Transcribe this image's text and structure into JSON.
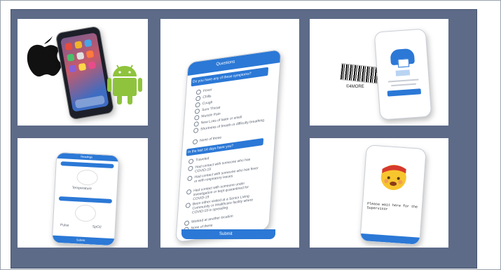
{
  "tiles": {
    "platforms": {
      "apple_icon": "apple-logo-icon",
      "android_icon": "android-robot-icon"
    },
    "questionnaire": {
      "header": "Questions",
      "q1": "Do you have any of these symptoms?",
      "symptoms": [
        "Fever",
        "Chills",
        "Cough",
        "Sore Throat",
        "Muscle Pain",
        "New Loss of taste or smell",
        "Shortness of breath or difficulty breathing",
        "None of these"
      ],
      "q2": "In the last 14 days have you?",
      "exposures": [
        "Traveled",
        "Had contact with someone who has COVID-19",
        "Had contact with someone who has fever or with respiratory issues",
        "Had contact with someone under investigation or kept quarantined for COVID-19",
        "Been either visited at a Senior Living Community or Healthcare facility where COVID-19 is spreading",
        "Worked at another location",
        "None of these"
      ],
      "submit": "Submit"
    },
    "badge": {
      "label": "©4MORE"
    },
    "vitals": {
      "header": "Readings",
      "temperature": "Temperature",
      "pulse": "Pulse",
      "spo2": "SpO2",
      "button": "Submit"
    },
    "result": {
      "message": "Please wait here for the Supervisor"
    }
  },
  "colors": {
    "accent": "#2b78d6",
    "board": "#5d6b88"
  }
}
